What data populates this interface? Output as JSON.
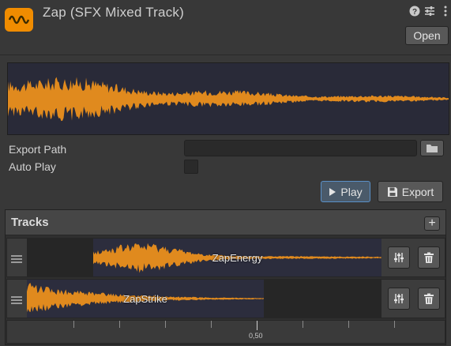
{
  "header": {
    "title": "Zap (SFX Mixed Track)",
    "icon": "waveform-icon",
    "open_label": "Open",
    "help_icon": "help-icon",
    "settings_icon": "sliders-icon",
    "menu_icon": "kebab-menu-icon"
  },
  "preview": {
    "waveform_color": "#e08a1e"
  },
  "fields": {
    "export_path_label": "Export Path",
    "export_path_value": "",
    "auto_play_label": "Auto Play",
    "auto_play_checked": false
  },
  "actions": {
    "play_label": "Play",
    "export_label": "Export"
  },
  "tracks": {
    "title": "Tracks",
    "add_label": "+",
    "items": [
      {
        "name": "ZapEnergy"
      },
      {
        "name": "ZapStrike"
      }
    ]
  },
  "timeline": {
    "marker_label": "0,50"
  },
  "colors": {
    "accent": "#f08c00",
    "waveform": "#e08a1e",
    "play_border": "#5a90c8"
  }
}
